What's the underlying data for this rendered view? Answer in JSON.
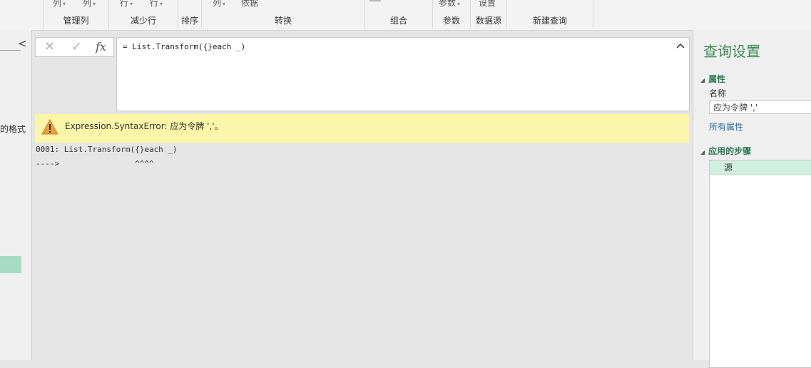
{
  "ribbon": {
    "top_fragments": [
      {
        "label": "列",
        "dropdown": true
      },
      {
        "label": "列",
        "dropdown": true
      },
      {
        "label": "行",
        "dropdown": true
      },
      {
        "label": "行",
        "dropdown": true
      },
      {
        "label": "列",
        "dropdown": true
      },
      {
        "label": "依据",
        "dropdown": false
      },
      {
        "label": "参数",
        "dropdown": true
      },
      {
        "label": "设置",
        "dropdown": false
      }
    ],
    "groups": [
      "管理列",
      "减少行",
      "排序",
      "转换",
      "组合",
      "参数",
      "数据源",
      "新建查询"
    ]
  },
  "nav": {
    "collapse_glyph": "<",
    "format_fragment": "的格式"
  },
  "formula_bar": {
    "cancel_icon": "close-icon",
    "confirm_icon": "check-icon",
    "fx_label": "fx",
    "formula": "= List.Transform({}each _)",
    "expand_icon": "chevron-up-icon"
  },
  "error": {
    "icon": "warning-icon",
    "message": "Expression.SyntaxError: 应为令牌 ','。"
  },
  "details": {
    "line1": "0001: List.Transform({}each _)",
    "line2": "---->                ^^^^"
  },
  "query_settings": {
    "title": "查询设置",
    "properties_header": "属性",
    "name_label": "名称",
    "name_value": "应为令牌 ','",
    "all_properties_link": "所有属性",
    "applied_steps_header": "应用的步骤",
    "steps": [
      "源"
    ]
  },
  "colors": {
    "accent_green": "#3a8a55",
    "error_banner": "#fbf6a9",
    "selected_step": "#d2f0df"
  }
}
